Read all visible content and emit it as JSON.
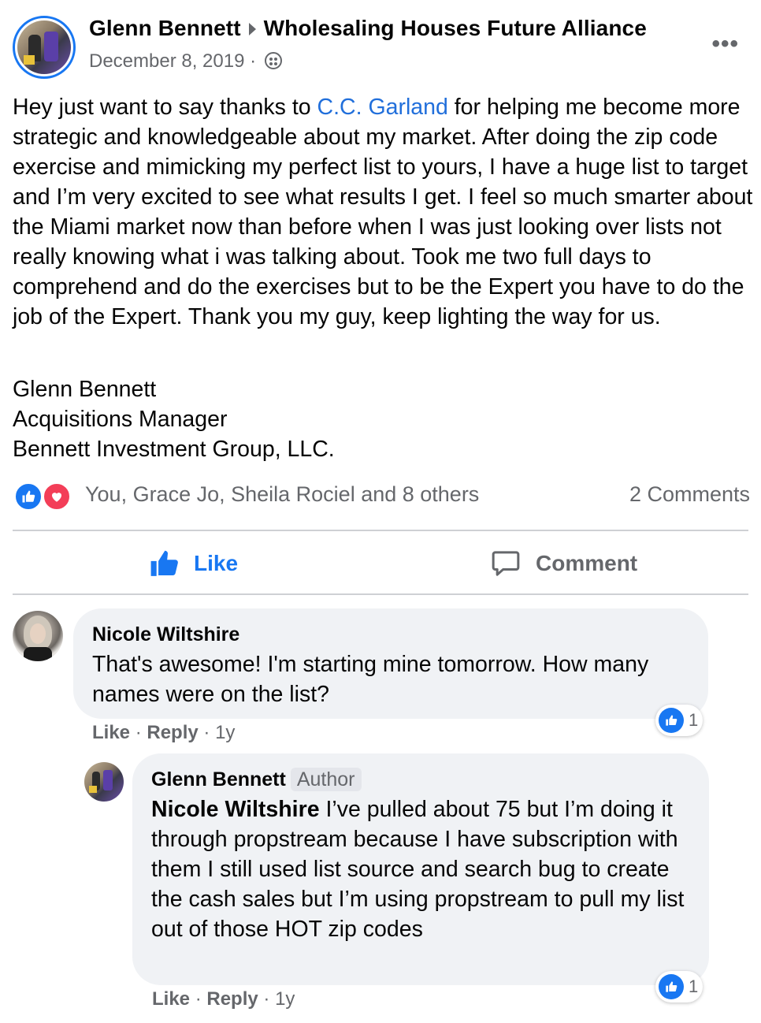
{
  "post": {
    "author": "Glenn Bennett",
    "group": "Wholesaling Houses Future Alliance",
    "date": "December 8, 2019 ·",
    "privacy_icon": "globe-icon",
    "more_icon": "more-icon",
    "more_label": "•••",
    "body_before_mention": "Hey just want to say thanks to ",
    "mention": "C.C. Garland",
    "body_after_mention": " for helping me become more strategic and knowledgeable about my market. After doing the zip code exercise and mimicking my perfect list to yours, I have a huge list to target and I’m very excited to see what results I get. I feel so much smarter about the Miami market now than before when I was just looking over lists not really knowing what i was talking about. Took me two full days to comprehend and do the exercises but to be the Expert you have to do the job of the Expert. Thank you my guy, keep lighting the way for us.",
    "signature": [
      "Glenn Bennett",
      "Acquisitions Manager",
      "Bennett Investment Group, LLC."
    ]
  },
  "reactions": {
    "icons": [
      "like-icon",
      "love-icon"
    ],
    "names": "You, Grace Jo, Sheila Rociel and 8 others",
    "comments": "2 Comments"
  },
  "actions": {
    "like": "Like",
    "comment": "Comment"
  },
  "comments": [
    {
      "author": "Nicole Wiltshire",
      "text": "That's awesome! I'm starting mine tomorrow. How many names were on the list?",
      "like_count": "1",
      "like_label": "Like",
      "reply_label": "Reply",
      "time": "1y",
      "sep": "·"
    },
    {
      "author": "Glenn Bennett",
      "badge": "Author",
      "mention": "Nicole Wiltshire",
      "text": " I’ve pulled about 75 but I’m doing it through propstream because I have subscription with them I still used list source and search bug to create the cash sales but I’m using propstream to pull my list out of those HOT zip codes",
      "like_count": "1",
      "like_label": "Like",
      "reply_label": "Reply",
      "time": "1y",
      "sep": "·"
    }
  ],
  "colors": {
    "accent": "#1877f2",
    "love": "#f33e58",
    "mention": "#216fdb",
    "secondary_text": "#65676b",
    "bubble": "#f0f2f5"
  }
}
